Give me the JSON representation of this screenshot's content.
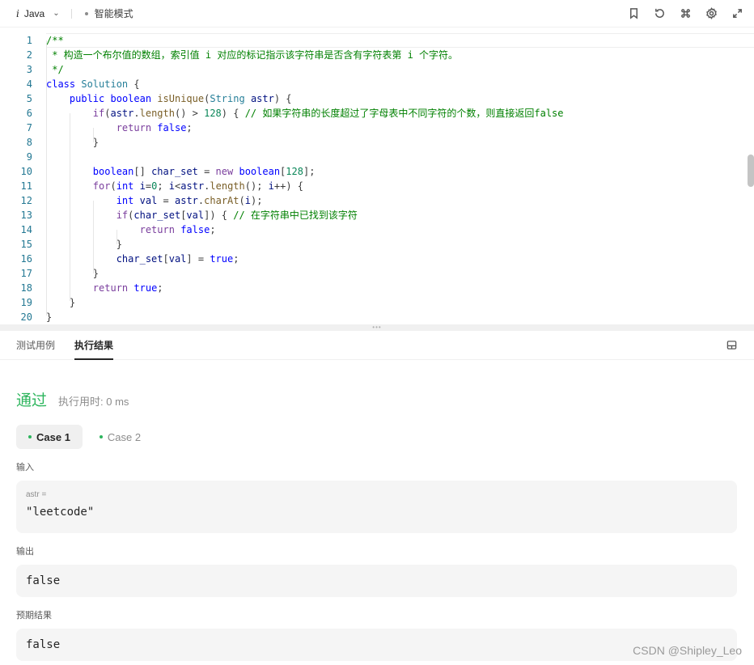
{
  "toolbar": {
    "language": "Java",
    "language_icon": "italic-i-icon",
    "mode": "智能模式",
    "icons": [
      "bookmark-icon",
      "reset-icon",
      "command-icon",
      "settings-icon",
      "expand-icon"
    ]
  },
  "editor": {
    "line_numbers": [
      "1",
      "2",
      "3",
      "4",
      "5",
      "6",
      "7",
      "8",
      "9",
      "10",
      "11",
      "12",
      "13",
      "14",
      "15",
      "16",
      "17",
      "18",
      "19",
      "20"
    ]
  },
  "panel": {
    "tabs": [
      "测试用例",
      "执行结果"
    ],
    "active_tab": "执行结果"
  },
  "result": {
    "status": "通过",
    "runtime": "执行用时: 0 ms",
    "cases": [
      "Case 1",
      "Case 2"
    ],
    "input_label": "输入",
    "input_var": "astr =",
    "input_value": "\"leetcode\"",
    "output_label": "输出",
    "output_value": "false",
    "expected_label": "预期结果",
    "expected_value": "false"
  },
  "watermark": "CSDN @Shipley_Leo",
  "colors": {
    "accent_green": "#2db55d",
    "keyword": "#7a3e9d",
    "comment": "#008000",
    "line_number": "#237893"
  }
}
